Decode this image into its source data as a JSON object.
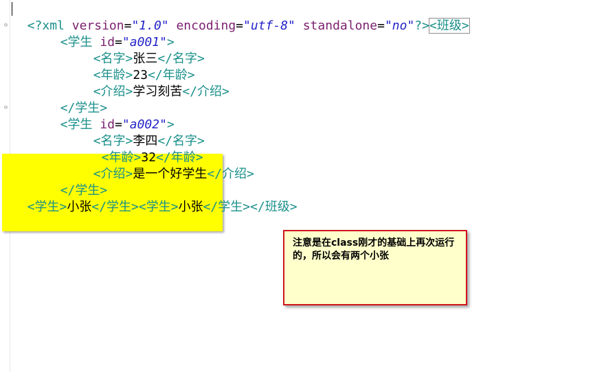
{
  "editor": {
    "line1": {
      "open": "<?",
      "name": "xml",
      "attr1": "version",
      "eq": "=",
      "val1": "\"1.0\"",
      "attr2": "encoding",
      "val2": "\"utf-8\"",
      "attr3": "standalone",
      "val3": "\"no\"",
      "close": "?>",
      "root_open": "<班级>"
    },
    "student1": {
      "open_tag": "<学生",
      "attr": "id",
      "eq": "=",
      "id_value": "\"a001\"",
      "gt": ">",
      "name_open": "<名字>",
      "name_value": "张三",
      "name_close": "</名字>",
      "age_open": "<年龄>",
      "age_value": "23",
      "age_close": "</年龄>",
      "intro_open": "<介绍>",
      "intro_value": "学习刻苦",
      "intro_close": "</介绍>",
      "close_tag": "</学生>"
    },
    "student2": {
      "open_tag": "<学生",
      "attr": "id",
      "eq": "=",
      "id_value": "\"a002\"",
      "gt": ">",
      "name_open": "<名字>",
      "name_value": "李四",
      "name_close": "</名字>",
      "age_open": "<年龄>",
      "age_value": "32",
      "age_close": "</年龄>",
      "intro_open": "<介绍>",
      "intro_value": "是一个好学生",
      "intro_close": "</介绍>",
      "close_tag": "</学生>"
    },
    "last_line": {
      "s1_open": "<学生>",
      "s1_value": "小张",
      "s1_close": "</学生>",
      "s2_open": "<学生>",
      "s2_value": "小张",
      "s2_close": "</学生>",
      "root_close": "</班级>"
    },
    "fold_icon": "minus-circle"
  },
  "annotation": {
    "text": "注意是在class刚才的基础上再次运行的，所以会有两个小张",
    "border_color": "#d0141b",
    "background": "#ffffcc",
    "highlight_color": "#ffff00"
  }
}
